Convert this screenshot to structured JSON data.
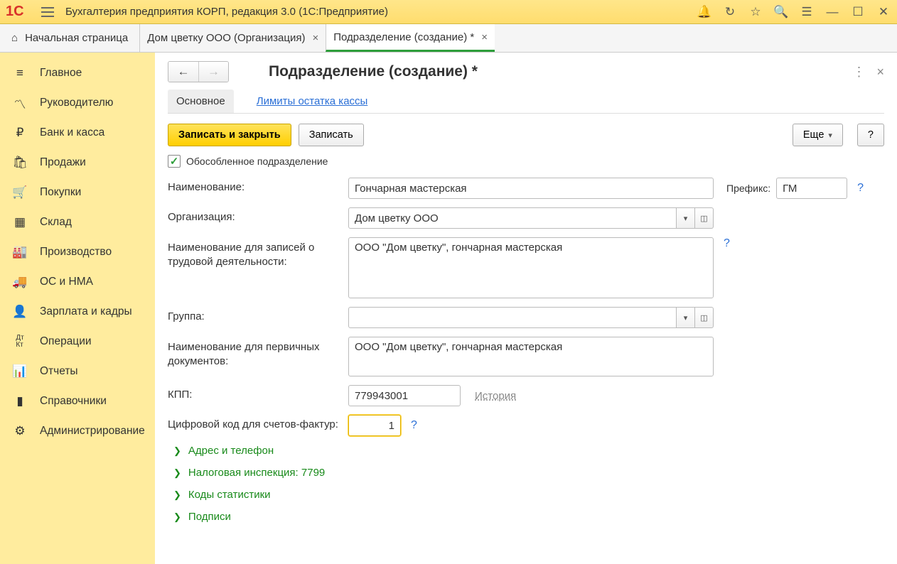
{
  "app": {
    "title": "Бухгалтерия предприятия КОРП, редакция 3.0  (1С:Предприятие)"
  },
  "tabs": {
    "home": "Начальная страница",
    "t1": "Дом цветку ООО (Организация)",
    "t2": "Подразделение (создание) *"
  },
  "nav": [
    "Главное",
    "Руководителю",
    "Банк и касса",
    "Продажи",
    "Покупки",
    "Склад",
    "Производство",
    "ОС и НМА",
    "Зарплата и кадры",
    "Операции",
    "Отчеты",
    "Справочники",
    "Администрирование"
  ],
  "page": {
    "title": "Подразделение (создание) *",
    "subtab_main": "Основное",
    "subtab_limits": "Лимиты остатка кассы",
    "btn_save_close": "Записать и закрыть",
    "btn_save": "Записать",
    "btn_more": "Еще",
    "btn_help": "?",
    "chk_separate": "Обособленное подразделение",
    "labels": {
      "name": "Наименование:",
      "prefix": "Префикс:",
      "org": "Организация:",
      "name_labor": "Наименование для записей о трудовой деятельности:",
      "group": "Группа:",
      "name_primary": "Наименование для первичных документов:",
      "kpp": "КПП:",
      "history": "История",
      "digital_code": "Цифровой код для счетов-фактур:"
    },
    "values": {
      "name": "Гончарная мастерская",
      "prefix": "ГМ",
      "org": "Дом цветку ООО",
      "name_labor": "ООО \"Дом цветку\", гончарная мастерская",
      "group": "",
      "name_primary": "ООО \"Дом цветку\", гончарная мастерская",
      "kpp": "779943001",
      "digital_code": "1"
    },
    "expanders": [
      "Адрес и телефон",
      "Налоговая инспекция: 7799",
      "Коды статистики",
      "Подписи"
    ]
  }
}
